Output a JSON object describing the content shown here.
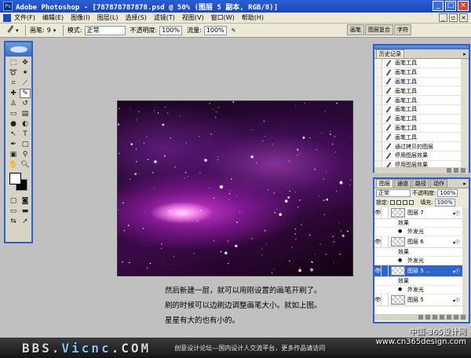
{
  "window": {
    "app_title": "Adobe Photoshop - [787878787878.psd @ 50% (图层 5 副本, RGB/8)]"
  },
  "menu": [
    "文件(F)",
    "编辑(E)",
    "图像(I)",
    "图层(L)",
    "选择(S)",
    "滤镜(T)",
    "视图(V)",
    "窗口(W)",
    "帮助(H)"
  ],
  "options": {
    "brush_label": "画笔:",
    "brush_size": "9",
    "mode_label": "模式:",
    "mode_value": "正常",
    "opacity_label": "不透明度:",
    "opacity_value": "100%",
    "flow_label": "流量:",
    "flow_value": "100%"
  },
  "palette_well": [
    "画笔",
    "图层复合",
    "字符"
  ],
  "history": {
    "tab": "历史记录",
    "items": [
      "画笔工具",
      "画笔工具",
      "画笔工具",
      "画笔工具",
      "画笔工具",
      "画笔工具",
      "画笔工具",
      "画笔工具",
      "画笔工具",
      "通过拷贝的图层",
      "停用图层效果",
      "停用图层效果",
      "停用图层效果"
    ],
    "selected_index": 12
  },
  "layers": {
    "tabs": [
      "图层",
      "通道",
      "路径",
      "动作"
    ],
    "blend_mode": "正常",
    "opacity_label": "不透明度:",
    "opacity_value": "100%",
    "lock_label": "锁定:",
    "fill_label": "填充:",
    "fill_value": "100%",
    "effects_label": "效果",
    "outer_glow_label": "外发光",
    "rows": [
      {
        "name": "图层 7"
      },
      {
        "name": "图层 6"
      },
      {
        "name": "图层 5 ..."
      },
      {
        "name": "图层 5"
      }
    ]
  },
  "caption": {
    "line1": "然后新建一层，就可以用刚设置的画笔开刷了。",
    "line2": "刷的时候可以边刷边调整画笔大小。就如上图。",
    "line3": "星星有大的也有小的。"
  },
  "banner": {
    "site_a": "BBS.",
    "site_b": "Vicnc",
    "site_c": ".COM",
    "slogan": "创意设计论坛—国内设计人交流平台，更多作品请访问"
  },
  "watermark": {
    "line1": "中国-365设计网",
    "line2": "www.cn365design.com"
  }
}
